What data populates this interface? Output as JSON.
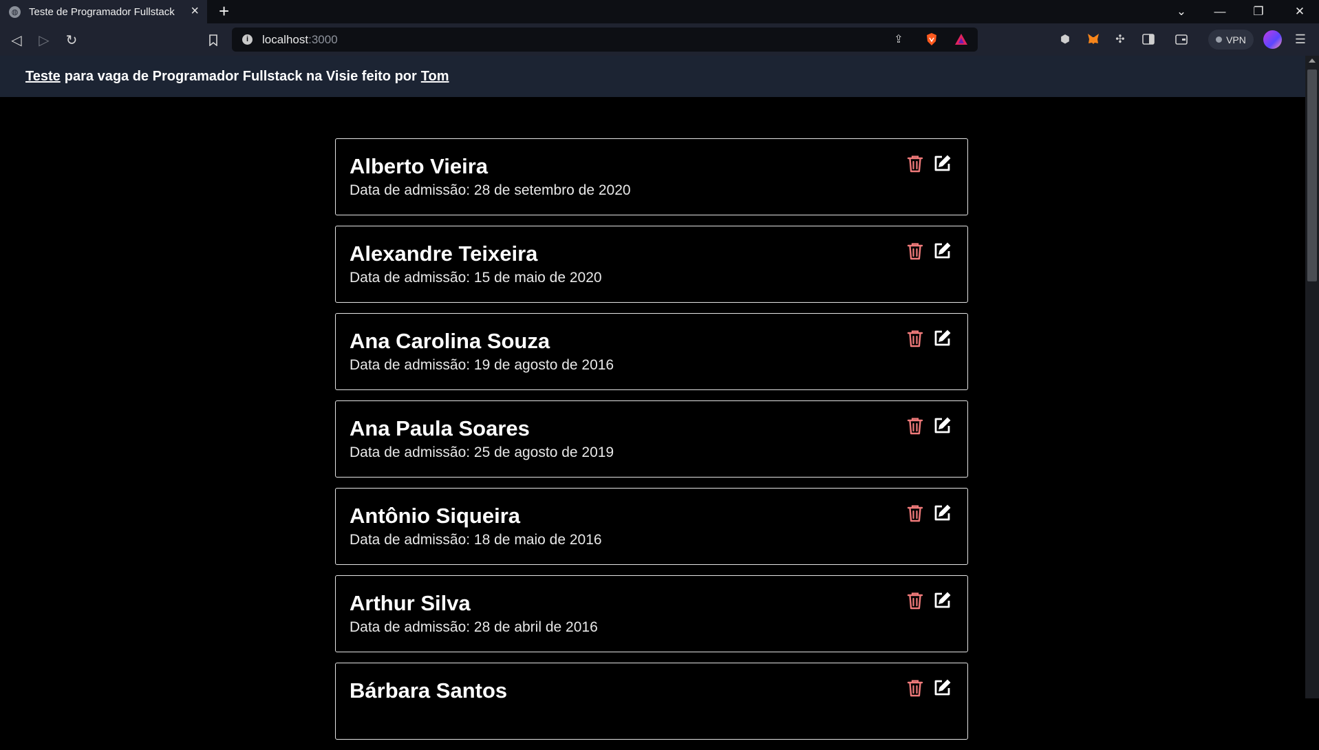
{
  "browser": {
    "tab_title": "Teste de Programador Fullstack",
    "new_tab_symbol": "+",
    "url_host": "localhost",
    "url_port": ":3000",
    "vpn_label": "VPN"
  },
  "header": {
    "link1": "Teste",
    "middle": "para vaga de Programador Fullstack na Visie feito por",
    "link2": "Tom"
  },
  "employees": [
    {
      "name": "Alberto Vieira",
      "date": "Data de admissão: 28 de setembro de 2020"
    },
    {
      "name": "Alexandre Teixeira",
      "date": "Data de admissão: 15 de maio de 2020"
    },
    {
      "name": "Ana Carolina Souza",
      "date": "Data de admissão: 19 de agosto de 2016"
    },
    {
      "name": "Ana Paula Soares",
      "date": "Data de admissão: 25 de agosto de 2019"
    },
    {
      "name": "Antônio Siqueira",
      "date": "Data de admissão: 18 de maio de 2016"
    },
    {
      "name": "Arthur Silva",
      "date": "Data de admissão: 28 de abril de 2016"
    },
    {
      "name": "Bárbara Santos",
      "date": ""
    }
  ],
  "colors": {
    "trash": "#f07a7a",
    "edit": "#ffffff",
    "header_bg": "#1c2433"
  }
}
